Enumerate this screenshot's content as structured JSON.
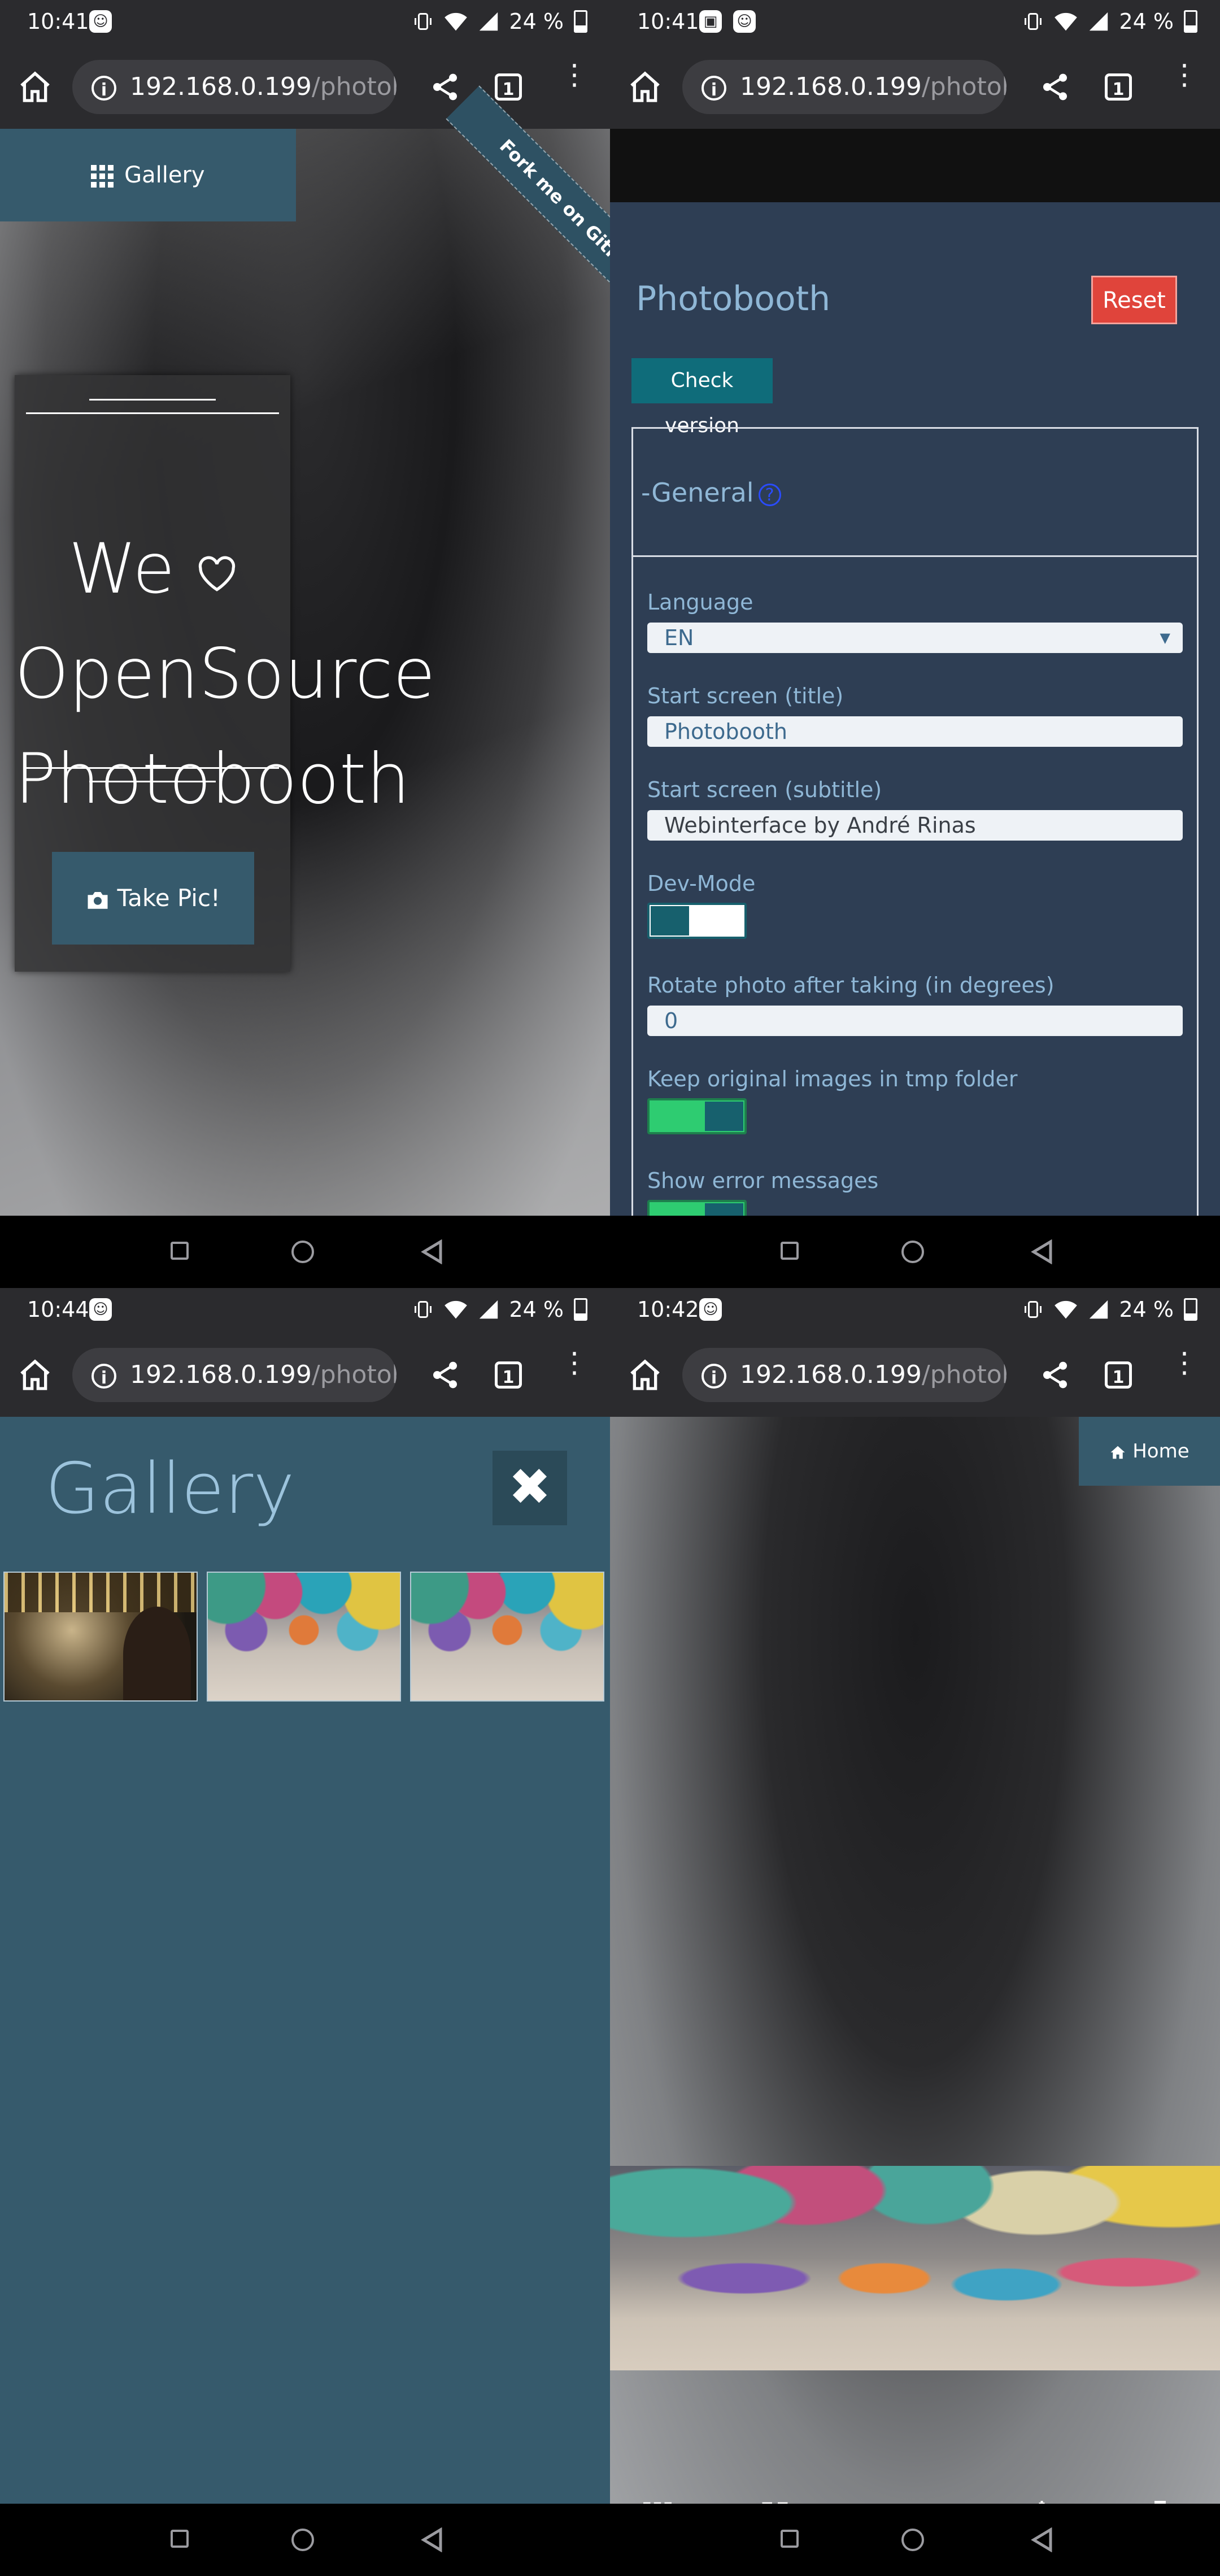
{
  "screens": [
    {
      "status": {
        "time": "10:41",
        "battery": "24 %"
      },
      "browser": {
        "host": "192.168.0.199",
        "path": "/photob",
        "tab_count": "1"
      },
      "start": {
        "gallery_label": "Gallery",
        "fork_label": "Fork me on GitHub",
        "title_we": "We",
        "title_rest": "OpenSource",
        "title_line2": "Photobooth",
        "take_pic_label": "Take Pic!"
      }
    },
    {
      "status": {
        "time": "10:41",
        "battery": "24 %"
      },
      "browser": {
        "host": "192.168.0.199",
        "path": "/photob",
        "tab_count": "1"
      },
      "admin": {
        "title": "Photobooth",
        "reset_label": "Reset",
        "check_version_label": "Check version",
        "section_label": "-General",
        "help_label": "?",
        "fields": {
          "language_label": "Language",
          "language_value": "EN",
          "start_title_label": "Start screen (title)",
          "start_title_placeholder": "Photobooth",
          "start_subtitle_label": "Start screen (subtitle)",
          "start_subtitle_value": "Webinterface by André Rinas",
          "dev_mode_label": "Dev-Mode",
          "rotate_label": "Rotate photo after taking (in degrees)",
          "rotate_placeholder": "0",
          "keep_original_label": "Keep original images in tmp folder",
          "show_errors_label": "Show error messages"
        },
        "toggles": {
          "dev_mode": false,
          "keep_original": true,
          "show_errors": true
        }
      }
    },
    {
      "status": {
        "time": "10:44",
        "battery": "24 %"
      },
      "browser": {
        "host": "192.168.0.199",
        "path": "/photob",
        "tab_count": "1"
      },
      "gallery": {
        "title": "Gallery",
        "close_label": "✖",
        "thumbnails": [
          "party",
          "balloons",
          "balloons"
        ]
      }
    },
    {
      "status": {
        "time": "10:42",
        "battery": "24 %"
      },
      "browser": {
        "host": "192.168.0.199",
        "path": "/photob",
        "tab_count": "1"
      },
      "viewer": {
        "home_label": "Home",
        "actions": [
          "grid-icon",
          "qrcode-icon",
          "camera-icon",
          "magic-wand-icon",
          "trash-icon"
        ]
      }
    }
  ],
  "colors": {
    "accent": "#365a6c",
    "reset": "#e0443b",
    "check_version": "#0f6c7a",
    "toggle_on": "#2ecc71"
  }
}
